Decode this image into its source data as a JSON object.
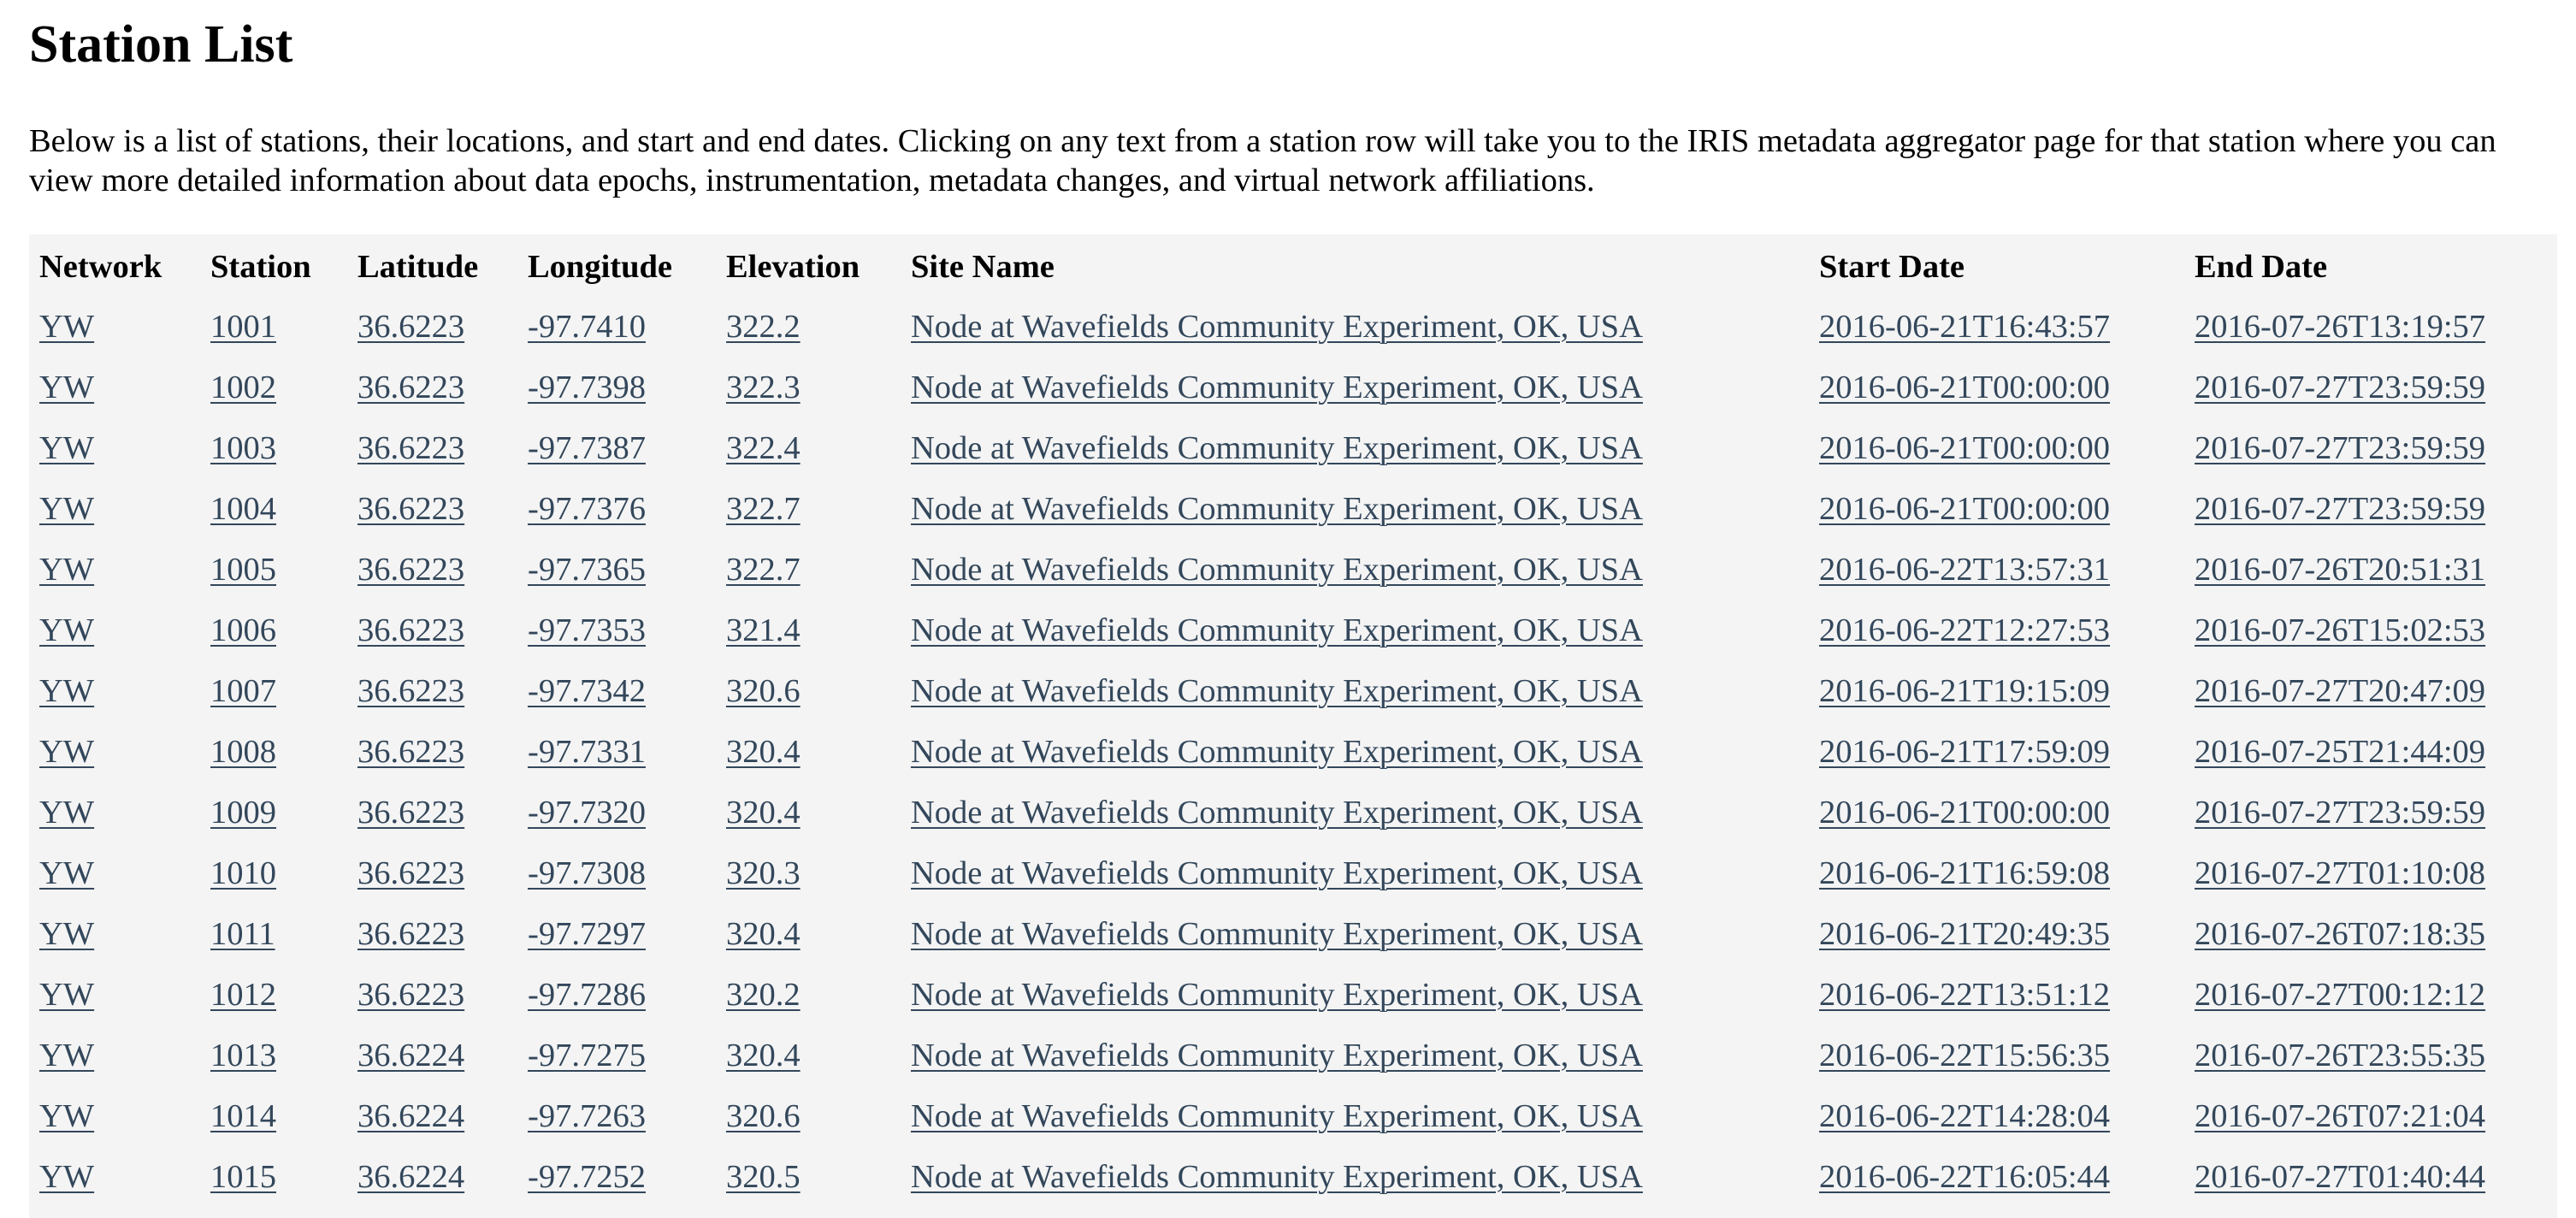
{
  "page": {
    "title": "Station List",
    "intro": "Below is a list of stations, their locations, and start and end dates. Clicking on any text from a station row will take you to the IRIS metadata aggregator page for that station where you can view more detailed information about data epochs, instrumentation, metadata changes, and virtual network affiliations."
  },
  "table": {
    "headers": [
      "Network",
      "Station",
      "Latitude",
      "Longitude",
      "Elevation",
      "Site Name",
      "Start Date",
      "End Date"
    ],
    "rows": [
      {
        "network": "YW",
        "station": "1001",
        "latitude": "36.6223",
        "longitude": "-97.7410",
        "elevation": "322.2",
        "site_name": "Node at Wavefields Community Experiment, OK, USA",
        "start_date": "2016-06-21T16:43:57",
        "end_date": "2016-07-26T13:19:57"
      },
      {
        "network": "YW",
        "station": "1002",
        "latitude": "36.6223",
        "longitude": "-97.7398",
        "elevation": "322.3",
        "site_name": "Node at Wavefields Community Experiment, OK, USA",
        "start_date": "2016-06-21T00:00:00",
        "end_date": "2016-07-27T23:59:59"
      },
      {
        "network": "YW",
        "station": "1003",
        "latitude": "36.6223",
        "longitude": "-97.7387",
        "elevation": "322.4",
        "site_name": "Node at Wavefields Community Experiment, OK, USA",
        "start_date": "2016-06-21T00:00:00",
        "end_date": "2016-07-27T23:59:59"
      },
      {
        "network": "YW",
        "station": "1004",
        "latitude": "36.6223",
        "longitude": "-97.7376",
        "elevation": "322.7",
        "site_name": "Node at Wavefields Community Experiment, OK, USA",
        "start_date": "2016-06-21T00:00:00",
        "end_date": "2016-07-27T23:59:59"
      },
      {
        "network": "YW",
        "station": "1005",
        "latitude": "36.6223",
        "longitude": "-97.7365",
        "elevation": "322.7",
        "site_name": "Node at Wavefields Community Experiment, OK, USA",
        "start_date": "2016-06-22T13:57:31",
        "end_date": "2016-07-26T20:51:31"
      },
      {
        "network": "YW",
        "station": "1006",
        "latitude": "36.6223",
        "longitude": "-97.7353",
        "elevation": "321.4",
        "site_name": "Node at Wavefields Community Experiment, OK, USA",
        "start_date": "2016-06-22T12:27:53",
        "end_date": "2016-07-26T15:02:53"
      },
      {
        "network": "YW",
        "station": "1007",
        "latitude": "36.6223",
        "longitude": "-97.7342",
        "elevation": "320.6",
        "site_name": "Node at Wavefields Community Experiment, OK, USA",
        "start_date": "2016-06-21T19:15:09",
        "end_date": "2016-07-27T20:47:09"
      },
      {
        "network": "YW",
        "station": "1008",
        "latitude": "36.6223",
        "longitude": "-97.7331",
        "elevation": "320.4",
        "site_name": "Node at Wavefields Community Experiment, OK, USA",
        "start_date": "2016-06-21T17:59:09",
        "end_date": "2016-07-25T21:44:09"
      },
      {
        "network": "YW",
        "station": "1009",
        "latitude": "36.6223",
        "longitude": "-97.7320",
        "elevation": "320.4",
        "site_name": "Node at Wavefields Community Experiment, OK, USA",
        "start_date": "2016-06-21T00:00:00",
        "end_date": "2016-07-27T23:59:59"
      },
      {
        "network": "YW",
        "station": "1010",
        "latitude": "36.6223",
        "longitude": "-97.7308",
        "elevation": "320.3",
        "site_name": "Node at Wavefields Community Experiment, OK, USA",
        "start_date": "2016-06-21T16:59:08",
        "end_date": "2016-07-27T01:10:08"
      },
      {
        "network": "YW",
        "station": "1011",
        "latitude": "36.6223",
        "longitude": "-97.7297",
        "elevation": "320.4",
        "site_name": "Node at Wavefields Community Experiment, OK, USA",
        "start_date": "2016-06-21T20:49:35",
        "end_date": "2016-07-26T07:18:35"
      },
      {
        "network": "YW",
        "station": "1012",
        "latitude": "36.6223",
        "longitude": "-97.7286",
        "elevation": "320.2",
        "site_name": "Node at Wavefields Community Experiment, OK, USA",
        "start_date": "2016-06-22T13:51:12",
        "end_date": "2016-07-27T00:12:12"
      },
      {
        "network": "YW",
        "station": "1013",
        "latitude": "36.6224",
        "longitude": "-97.7275",
        "elevation": "320.4",
        "site_name": "Node at Wavefields Community Experiment, OK, USA",
        "start_date": "2016-06-22T15:56:35",
        "end_date": "2016-07-26T23:55:35"
      },
      {
        "network": "YW",
        "station": "1014",
        "latitude": "36.6224",
        "longitude": "-97.7263",
        "elevation": "320.6",
        "site_name": "Node at Wavefields Community Experiment, OK, USA",
        "start_date": "2016-06-22T14:28:04",
        "end_date": "2016-07-26T07:21:04"
      },
      {
        "network": "YW",
        "station": "1015",
        "latitude": "36.6224",
        "longitude": "-97.7252",
        "elevation": "320.5",
        "site_name": "Node at Wavefields Community Experiment, OK, USA",
        "start_date": "2016-06-22T16:05:44",
        "end_date": "2016-07-27T01:40:44"
      }
    ]
  }
}
